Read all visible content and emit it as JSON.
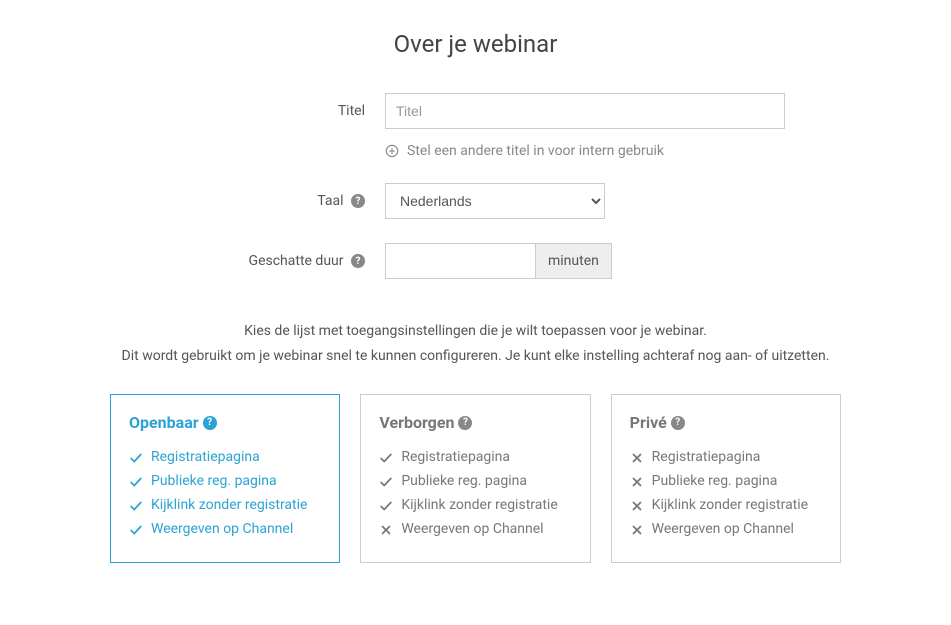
{
  "pageTitle": "Over je webinar",
  "form": {
    "titleLabel": "Titel",
    "titlePlaceholder": "Titel",
    "altTitleText": "Stel een andere titel in voor intern gebruik",
    "langLabel": "Taal",
    "langValue": "Nederlands",
    "durationLabel": "Geschatte duur",
    "durationSuffix": "minuten"
  },
  "intro": {
    "line1": "Kies de lijst met toegangsinstellingen die je wilt toepassen voor je webinar.",
    "line2": "Dit wordt gebruikt om je webinar snel te kunnen configureren. Je kunt elke instelling achteraf nog aan- of uitzetten."
  },
  "cards": {
    "open": {
      "title": "Openbaar",
      "items": [
        "Registratiepagina",
        "Publieke reg. pagina",
        "Kijklink zonder registratie",
        "Weergeven op Channel"
      ],
      "status": [
        "check",
        "check",
        "check",
        "check"
      ],
      "selected": true
    },
    "hidden": {
      "title": "Verborgen",
      "items": [
        "Registratiepagina",
        "Publieke reg. pagina",
        "Kijklink zonder registratie",
        "Weergeven op Channel"
      ],
      "status": [
        "check",
        "check",
        "check",
        "x"
      ],
      "selected": false
    },
    "private": {
      "title": "Privé",
      "items": [
        "Registratiepagina",
        "Publieke reg. pagina",
        "Kijklink zonder registratie",
        "Weergeven op Channel"
      ],
      "status": [
        "x",
        "x",
        "x",
        "x"
      ],
      "selected": false
    }
  }
}
